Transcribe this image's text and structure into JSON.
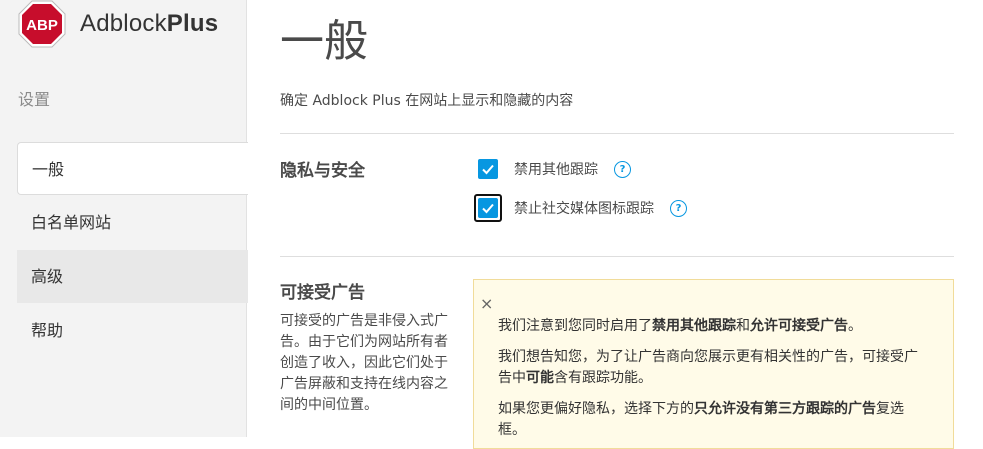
{
  "sidebar": {
    "brand_a": "Adblock",
    "brand_b": "Plus",
    "logo_text": "ABP",
    "heading": "设置",
    "items": [
      {
        "label": "一般",
        "state": "active"
      },
      {
        "label": "白名单网站",
        "state": "normal"
      },
      {
        "label": "高级",
        "state": "hover"
      },
      {
        "label": "帮助",
        "state": "normal"
      }
    ]
  },
  "main": {
    "title": "一般",
    "description": "确定 Adblock Plus 在网站上显示和隐藏的内容",
    "privacy": {
      "title": "隐私与安全",
      "options": [
        {
          "label": "禁用其他跟踪",
          "checked": true
        },
        {
          "label": "禁止社交媒体图标跟踪",
          "checked": true
        }
      ],
      "help_glyph": "?"
    },
    "acceptable": {
      "title": "可接受广告",
      "description": "可接受的广告是非侵入式广告。由于它们为网站所有者创造了收入，因此它们处于广告屏蔽和支持在线内容之间的中间位置。"
    },
    "notice": {
      "close_glyph": "×",
      "p1_pre": "我们注意到您同时启用了",
      "p1_b1": "禁用其他跟踪",
      "p1_mid": "和",
      "p1_b2": "允许可接受广告",
      "p1_end": "。",
      "p2_pre": "我们想告知您，为了让广告商向您展示更有相关性的广告，可接受广告中",
      "p2_b": "可能",
      "p2_end": "含有跟踪功能。",
      "p3_pre": "如果您更偏好隐私，选择下方的",
      "p3_b": "只允许没有第三方跟踪的广告",
      "p3_end": "复选框。"
    }
  },
  "colors": {
    "accent": "#0797e1",
    "logo_red": "#c70d2c",
    "notice_bg": "#fffbe8",
    "notice_border": "#f1dc9a"
  }
}
